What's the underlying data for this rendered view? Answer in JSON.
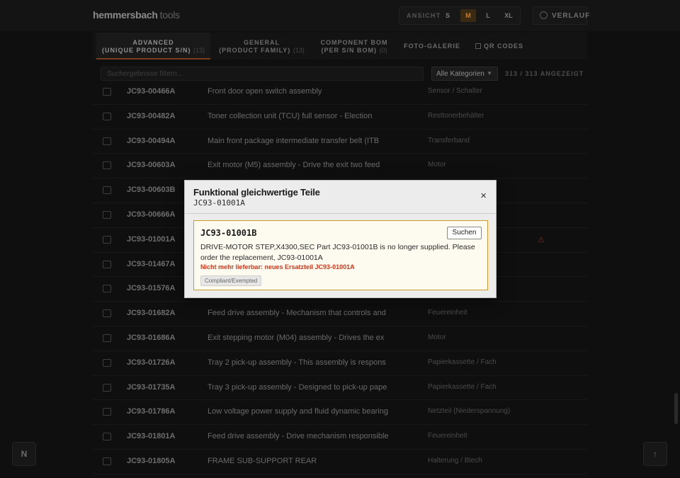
{
  "brand": {
    "name": "hemmersbach",
    "suffix": "tools"
  },
  "view": {
    "label": "ANSICHT",
    "options": [
      "S",
      "M",
      "L",
      "XL"
    ],
    "active_index": 1
  },
  "history": {
    "label": "VERLAUF",
    "icon": "clock-icon"
  },
  "tabs": [
    {
      "title": "ADVANCED",
      "subtitle": "(UNIQUE PRODUCT S/N)",
      "count": "(13)",
      "active": true
    },
    {
      "title": "GENERAL",
      "subtitle": "(PRODUCT FAMILY)",
      "count": "(13)",
      "active": false
    },
    {
      "title": "COMPONENT BOM",
      "subtitle": "(PER S/N BOM)",
      "count": "(0)",
      "active": false
    },
    {
      "title": "FOTO-GALERIE",
      "subtitle": "",
      "count": "",
      "active": false
    },
    {
      "title": "QR CODES",
      "subtitle": "",
      "count": "",
      "active": false
    }
  ],
  "filter": {
    "placeholder": "Suchergebnisse filtern...",
    "category": "Alle Kategorien",
    "count": "313 / 313 ANGEZEIGT"
  },
  "rows": [
    {
      "pn": "JC93-00466A",
      "desc": "Front door open switch assembly",
      "cat": "Sensor / Schalter"
    },
    {
      "pn": "JC93-00482A",
      "desc": "Toner collection unit (TCU) full sensor - Election",
      "cat": "Resttonerbehälter"
    },
    {
      "pn": "JC93-00494A",
      "desc": "Main front package intermediate transfer belt (ITB",
      "cat": "Transferband"
    },
    {
      "pn": "JC93-00603A",
      "desc": "Exit motor (M5) assembly - Drive the exit two feed",
      "cat": "Motor"
    },
    {
      "pn": "JC93-00603B",
      "desc": "",
      "cat": ""
    },
    {
      "pn": "JC93-00666A",
      "desc": "",
      "cat": ""
    },
    {
      "pn": "JC93-01001A",
      "desc": "",
      "cat": "",
      "warn": true
    },
    {
      "pn": "JC93-01467A",
      "desc": "",
      "cat": ""
    },
    {
      "pn": "JC93-01576A",
      "desc": "",
      "cat": ""
    },
    {
      "pn": "JC93-01682A",
      "desc": "Feed drive assembly - Mechanism that controls and",
      "cat": "Feuereinheit"
    },
    {
      "pn": "JC93-01686A",
      "desc": "Exit stepping motor (M04) assembly - Drives the ex",
      "cat": "Motor"
    },
    {
      "pn": "JC93-01726A",
      "desc": "Tray 2 pick-up assembly - This assembly is respons",
      "cat": "Papierkassette / Fach"
    },
    {
      "pn": "JC93-01735A",
      "desc": "Tray 3 pick-up assembly - Designed to pick-up pape",
      "cat": "Papierkassette / Fach"
    },
    {
      "pn": "JC93-01786A",
      "desc": "Low voltage power supply and fluid dynamic bearing",
      "cat": "Netzteil (Niederspannung)"
    },
    {
      "pn": "JC93-01801A",
      "desc": "Feed drive assembly - Drive mechanism responsible",
      "cat": "Feuereinheit"
    },
    {
      "pn": "JC93-01805A",
      "desc": "FRAME SUB-SUPPORT REAR",
      "cat": "Halterung / Blech"
    }
  ],
  "modal": {
    "title": "Funktional gleichwertige Teile",
    "part_number": "JC93-01001A",
    "close": "×",
    "card": {
      "code": "JC93-01001B",
      "button": "Suchen",
      "description": "DRIVE-MOTOR STEP,X4300,SEC Part JC93-01001B is no longer supplied. Please order the replacement, JC93-01001A",
      "warning": "Nicht mehr lieferbar: neues Ersatzteil JC93-01001A",
      "badge": "Compliant/Exempted"
    }
  },
  "fab": {
    "left": "N",
    "right": "↑"
  }
}
